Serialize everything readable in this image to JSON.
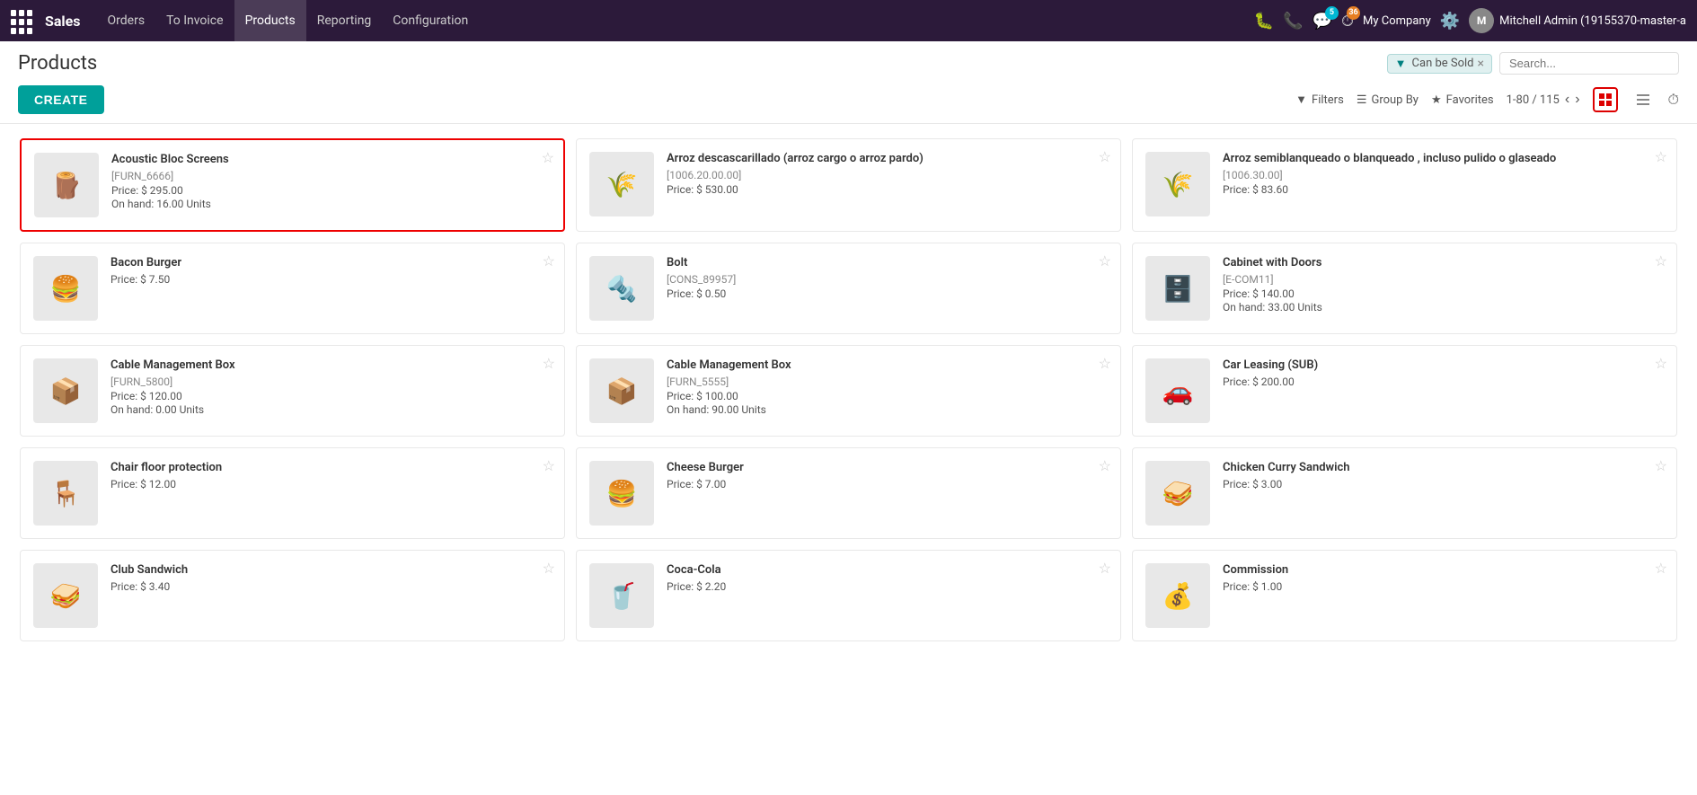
{
  "topnav": {
    "brand": "Sales",
    "menu": [
      {
        "label": "Orders",
        "id": "orders"
      },
      {
        "label": "To Invoice",
        "id": "to-invoice"
      },
      {
        "label": "Products",
        "id": "products"
      },
      {
        "label": "Reporting",
        "id": "reporting"
      },
      {
        "label": "Configuration",
        "id": "configuration"
      }
    ],
    "notification_count": "5",
    "clock_count": "36",
    "company": "My Company",
    "user": "Mitchell Admin (19155370-master-a"
  },
  "page": {
    "title": "Products"
  },
  "filter": {
    "label": "Can be Sold",
    "search_placeholder": "Search..."
  },
  "toolbar": {
    "create_label": "CREATE",
    "filters_label": "Filters",
    "groupby_label": "Group By",
    "favorites_label": "Favorites",
    "pagination": "1-80 / 115"
  },
  "products": [
    {
      "name": "Acoustic Bloc Screens",
      "code": "[FURN_6666]",
      "price": "Price: $ 295.00",
      "onhand": "On hand: 16.00 Units",
      "emoji": "🪵",
      "selected": true
    },
    {
      "name": "Arroz descascarillado (arroz cargo o arroz pardo)",
      "code": "[1006.20.00.00]",
      "price": "Price: $ 530.00",
      "onhand": "",
      "emoji": "🌾",
      "selected": false
    },
    {
      "name": "Arroz semiblanqueado o blanqueado , incluso pulido o glaseado",
      "code": "[1006.30.00]",
      "price": "Price: $ 83.60",
      "onhand": "",
      "emoji": "🌾",
      "selected": false
    },
    {
      "name": "Bacon Burger",
      "code": "",
      "price": "Price: $ 7.50",
      "onhand": "",
      "emoji": "🍔",
      "selected": false
    },
    {
      "name": "Bolt",
      "code": "[CONS_89957]",
      "price": "Price: $ 0.50",
      "onhand": "",
      "emoji": "🔩",
      "selected": false
    },
    {
      "name": "Cabinet with Doors",
      "code": "[E-COM11]",
      "price": "Price: $ 140.00",
      "onhand": "On hand: 33.00 Units",
      "emoji": "🗄️",
      "selected": false
    },
    {
      "name": "Cable Management Box",
      "code": "[FURN_5800]",
      "price": "Price: $ 120.00",
      "onhand": "On hand: 0.00 Units",
      "emoji": "📦",
      "selected": false
    },
    {
      "name": "Cable Management Box",
      "code": "[FURN_5555]",
      "price": "Price: $ 100.00",
      "onhand": "On hand: 90.00 Units",
      "emoji": "📦",
      "selected": false
    },
    {
      "name": "Car Leasing (SUB)",
      "code": "",
      "price": "Price: $ 200.00",
      "onhand": "",
      "emoji": "🚗",
      "selected": false
    },
    {
      "name": "Chair floor protection",
      "code": "",
      "price": "Price: $ 12.00",
      "onhand": "",
      "emoji": "🪑",
      "selected": false
    },
    {
      "name": "Cheese Burger",
      "code": "",
      "price": "Price: $ 7.00",
      "onhand": "",
      "emoji": "🍔",
      "selected": false
    },
    {
      "name": "Chicken Curry Sandwich",
      "code": "",
      "price": "Price: $ 3.00",
      "onhand": "",
      "emoji": "🥪",
      "selected": false
    },
    {
      "name": "Club Sandwich",
      "code": "",
      "price": "Price: $ 3.40",
      "onhand": "",
      "emoji": "🥪",
      "selected": false
    },
    {
      "name": "Coca-Cola",
      "code": "",
      "price": "Price: $ 2.20",
      "onhand": "",
      "emoji": "🥤",
      "selected": false
    },
    {
      "name": "Commission",
      "code": "",
      "price": "Price: $ 1.00",
      "onhand": "",
      "emoji": "💰",
      "selected": false
    }
  ]
}
